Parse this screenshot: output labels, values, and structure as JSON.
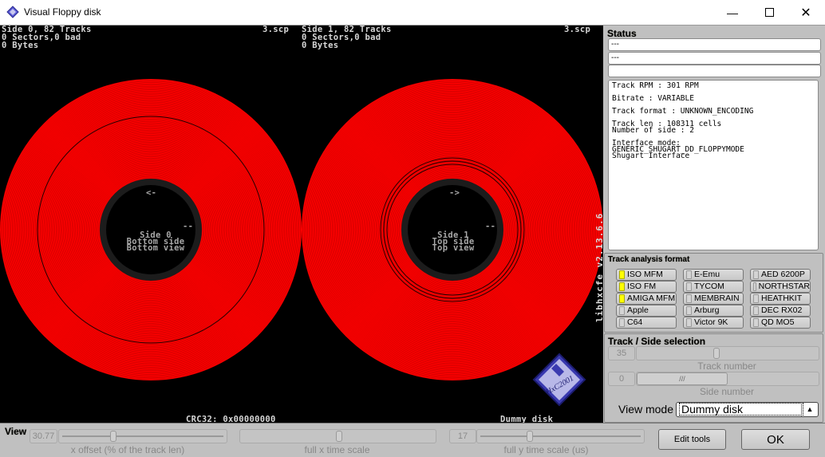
{
  "window": {
    "title": "Visual Floppy disk",
    "minimize_icon": "minimize-icon",
    "maximize_icon": "maximize-icon",
    "close_icon": "close-icon"
  },
  "viewer": {
    "side0": {
      "header_line1": "Side 0, 82 Tracks",
      "header_line2": "0 Sectors,0 bad",
      "header_line3": "0 Bytes",
      "filename": "3.scp",
      "arrow": "<-",
      "index_mark": "--",
      "hub_line1": "Side 0",
      "hub_line2": "Bottom side",
      "hub_line3": "Bottom view"
    },
    "side1": {
      "header_line1": "Side 1, 82 Tracks",
      "header_line2": "0 Sectors,0 bad",
      "header_line3": "0 Bytes",
      "filename": "3.scp",
      "arrow": "->",
      "index_mark": "--",
      "hub_line1": "Side 1",
      "hub_line2": "Top side",
      "hub_line3": "Top view"
    },
    "crc": "CRC32: 0x00000000",
    "mode_label": "Dummy disk",
    "version": "libhxcfe v2.13.6.6",
    "logo_text": "HxC2001",
    "url": "https://hxc2001.com",
    "disk_color": "#ff0000",
    "tracks": 82
  },
  "status": {
    "label": "Status",
    "field1": "---",
    "field2": "---",
    "field3": "",
    "info_lines": [
      "Track RPM : 301 RPM",
      "Bitrate : VARIABLE",
      "Track format : UNKNOWN_ENCODING",
      "Track len : 108311 cells",
      "Number of side : 2",
      "Interface mode:",
      "GENERIC_SHUGART_DD_FLOPPYMODE",
      "Shugart Interface"
    ]
  },
  "track_analysis": {
    "label": "Track analysis format",
    "formats": [
      {
        "label": "ISO MFM",
        "on": true
      },
      {
        "label": "E-Emu",
        "on": false
      },
      {
        "label": "AED 6200P",
        "on": false
      },
      {
        "label": "ISO FM",
        "on": true
      },
      {
        "label": "TYCOM",
        "on": false
      },
      {
        "label": "NORTHSTAR",
        "on": false
      },
      {
        "label": "AMIGA MFM",
        "on": true
      },
      {
        "label": "MEMBRAIN",
        "on": false
      },
      {
        "label": "HEATHKIT",
        "on": false
      },
      {
        "label": "Apple",
        "on": false
      },
      {
        "label": "Arburg",
        "on": false
      },
      {
        "label": "DEC RX02",
        "on": false
      },
      {
        "label": "C64",
        "on": false
      },
      {
        "label": "Victor 9K",
        "on": false
      },
      {
        "label": "QD MO5",
        "on": false
      }
    ]
  },
  "track_side": {
    "label": "Track / Side selection",
    "track_value": "35",
    "track_label": "Track number",
    "track_fraction": 0.43,
    "side_value": "0",
    "side_label": "Side number",
    "side_fraction": 0.0,
    "view_mode_label": "View mode",
    "view_mode_value": "Dummy disk"
  },
  "view": {
    "label": "View",
    "x_offset_value": "30.77",
    "x_offset_label": "x offset (% of the track len)",
    "x_offset_fraction": 0.3077,
    "x_scale_label": "full x time scale",
    "x_scale_fraction": 0.5,
    "y_scale_value": "17",
    "y_scale_label": "full y time scale (us)",
    "y_scale_fraction": 0.3,
    "edit_tools": "Edit tools",
    "ok": "OK"
  }
}
